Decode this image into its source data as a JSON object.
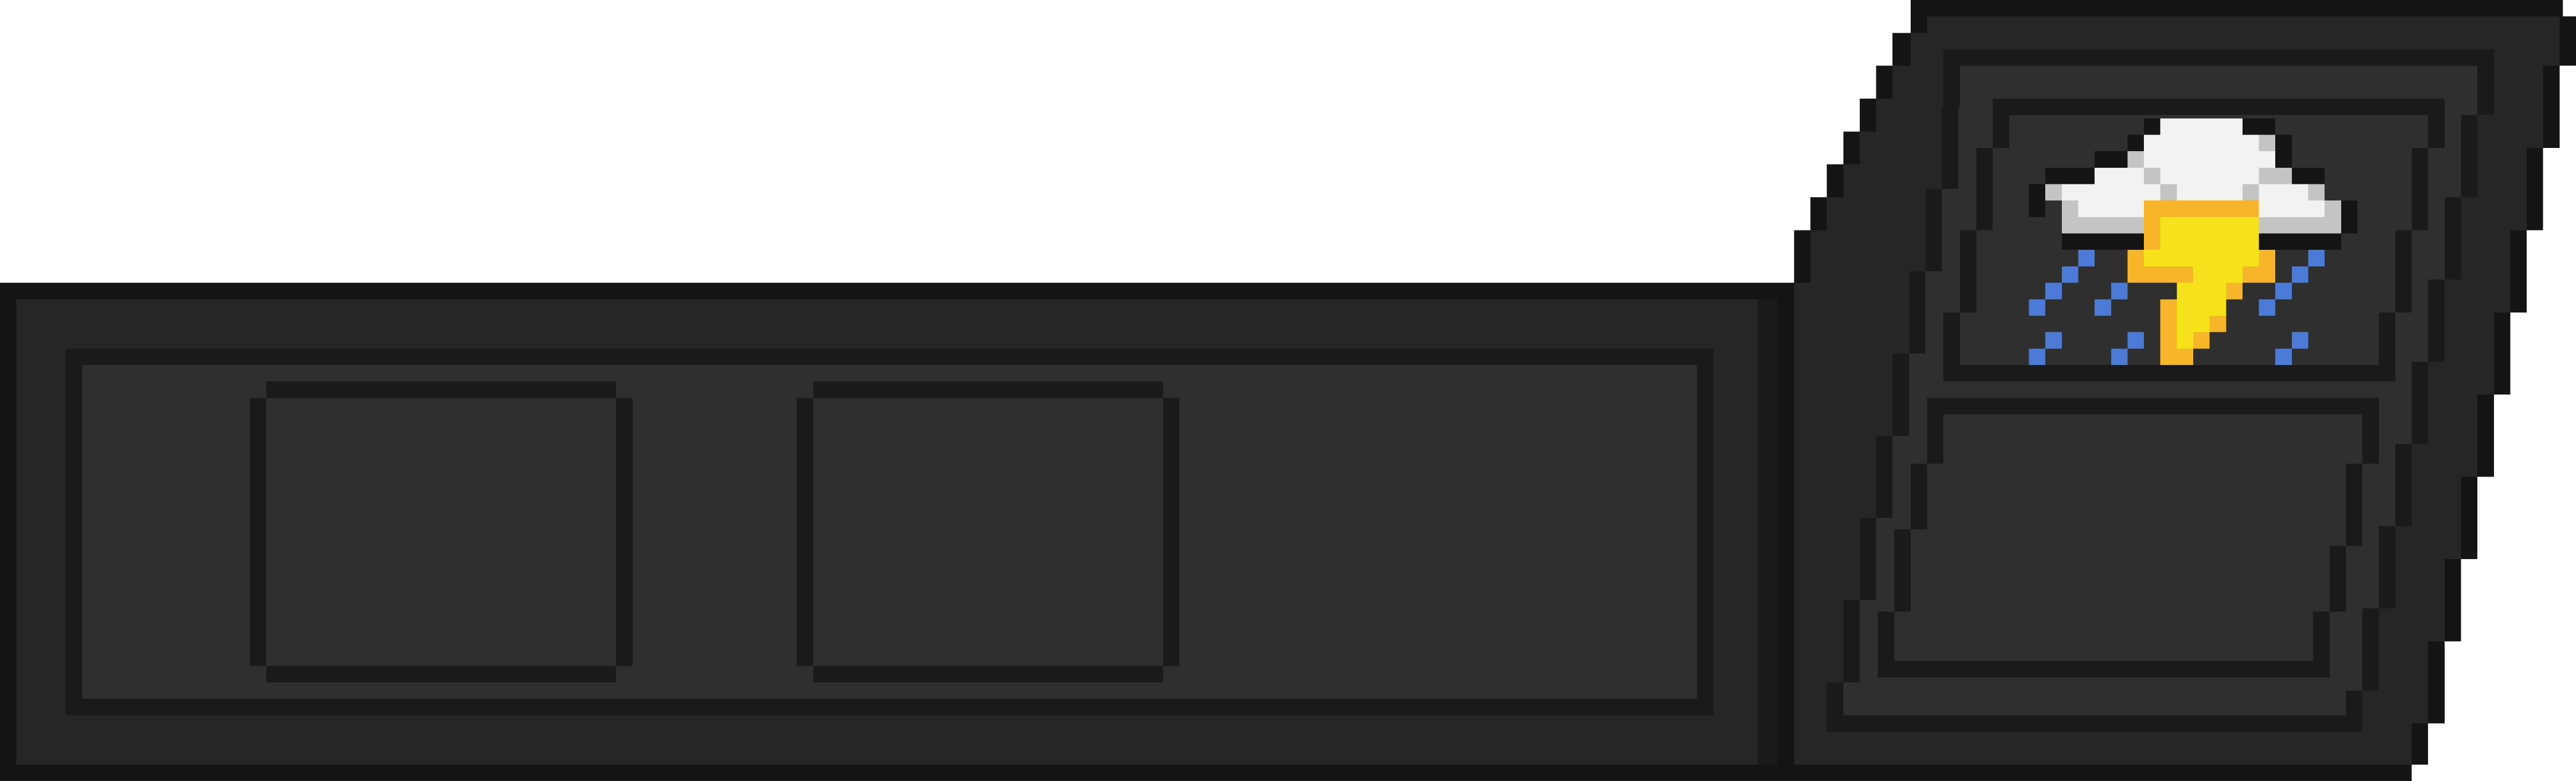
{
  "hud": {
    "weather": {
      "icon": "thunderstorm-icon",
      "condition": "thunderstorm"
    },
    "inventory": {
      "slot_count": 2,
      "slots": [
        {
          "icon": "empty-slot-icon",
          "item": ""
        },
        {
          "icon": "empty-slot-icon",
          "item": ""
        }
      ]
    },
    "info_panel": {
      "text": ""
    }
  },
  "colors": {
    "outline": "#141414",
    "frame": "#262626",
    "panel_fill": "#2f2f2f",
    "inner_line": "#1a1a1a",
    "cloud_light": "#f2f2f2",
    "cloud_shade": "#c4c4c4",
    "bolt_yellow": "#f6e21a",
    "bolt_orange": "#f7b52c",
    "rain_blue": "#4b7bd6"
  }
}
